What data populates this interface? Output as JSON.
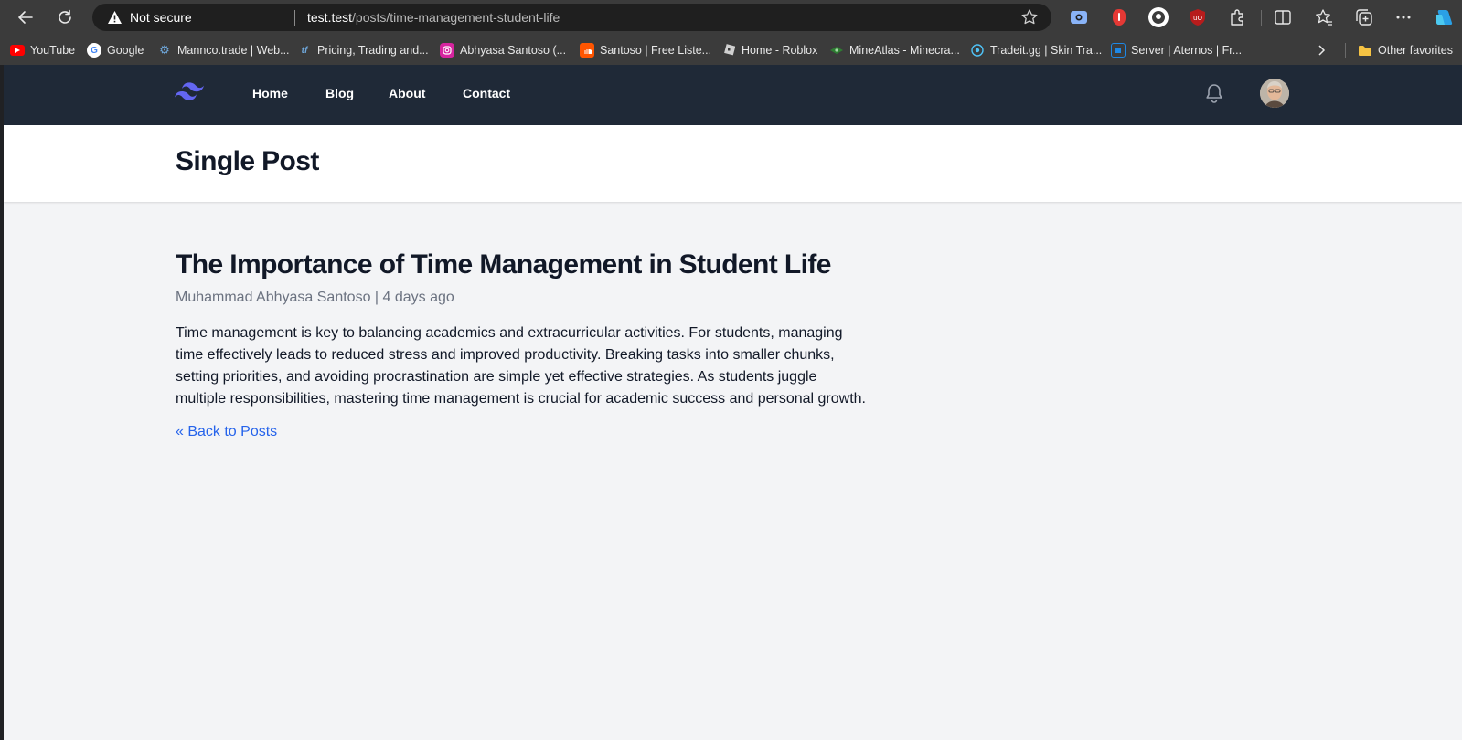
{
  "browser": {
    "security_label": "Not secure",
    "url_host": "test.test",
    "url_path": "/posts/time-management-student-life",
    "bookmarks": [
      {
        "label": "YouTube",
        "icon": "youtube-icon",
        "color": "#ff0000"
      },
      {
        "label": "Google",
        "icon": "google-icon",
        "color": "#4285f4"
      },
      {
        "label": "Mannco.trade | Web...",
        "icon": "mannco-icon",
        "color": "#6fa8dc"
      },
      {
        "label": "Pricing, Trading and...",
        "icon": "tf-icon",
        "color": "#3c78d8"
      },
      {
        "label": "Abhyasa Santoso (...",
        "icon": "instagram-icon",
        "color": "#d6249f"
      },
      {
        "label": "Santoso | Free Liste...",
        "icon": "soundcloud-icon",
        "color": "#ff5500"
      },
      {
        "label": "Home - Roblox",
        "icon": "roblox-icon",
        "color": "#d0d0d0"
      },
      {
        "label": "MineAtlas - Minecra...",
        "icon": "mineatlas-icon",
        "color": "#2e7d32"
      },
      {
        "label": "Tradeit.gg | Skin Tra...",
        "icon": "tradeit-icon",
        "color": "#4fc3f7"
      },
      {
        "label": "Server | Aternos | Fr...",
        "icon": "aternos-icon",
        "color": "#1e88e5"
      },
      {
        "label": "Other favorites",
        "icon": "folder-icon",
        "color": "#f6c343"
      }
    ]
  },
  "nav": {
    "links": [
      "Home",
      "Blog",
      "About",
      "Contact"
    ]
  },
  "header": {
    "title": "Single Post"
  },
  "post": {
    "title": "The Importance of Time Management in Student Life",
    "author": "Muhammad Abhyasa Santoso",
    "separator": "|",
    "date": "4 days ago",
    "body": "Time management is key to balancing academics and extracurricular activities. For students, managing time effectively leads to reduced stress and improved productivity. Breaking tasks into smaller chunks, setting priorities, and avoiding procrastination are simple yet effective strategies. As students juggle multiple responsibilities, mastering time management is crucial for academic success and personal growth.",
    "back_label": "« Back to Posts"
  },
  "colors": {
    "nav_bg": "#1f2937",
    "page_bg": "#f3f4f6",
    "link": "#2563eb",
    "logo": "#6366f1"
  }
}
